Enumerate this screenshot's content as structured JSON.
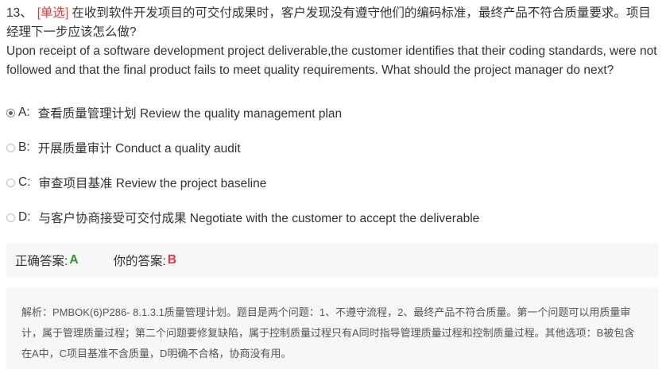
{
  "question": {
    "number": "13、",
    "type": "[单选]",
    "text_cn": "在收到软件开发项目的可交付成果时，客户发现没有遵守他们的编码标准，最终产品不符合质量要求。项目经理下一步应该怎么做?",
    "text_en": "Upon receipt of a software development project deliverable,the customer identifies that their coding standards, were not followed and that the final product fails to meet quality requirements. What should the project manager do next?"
  },
  "options": [
    {
      "letter": "A:",
      "text": "查看质量管理计划 Review the quality management plan",
      "selected": true
    },
    {
      "letter": "B:",
      "text": "开展质量审计 Conduct a quality audit",
      "selected": false
    },
    {
      "letter": "C:",
      "text": "审查项目基准 Review the project baseline",
      "selected": false
    },
    {
      "letter": "D:",
      "text": "与客户协商接受可交付成果 Negotiate with the customer to accept the deliverable",
      "selected": false
    }
  ],
  "answer": {
    "correct_label": "正确答案:",
    "correct_value": "A",
    "yours_label": "你的答案:",
    "yours_value": "B",
    "correct_color": "#2a9a2a",
    "wrong_color": "#e4393c"
  },
  "explanation": {
    "text": "解析：PMBOK(6)P286- 8.1.3.1质量管理计划。题目是两个问题：1、不遵守流程，2、最终产品不符合质量。第一个问题可以用质量审计，属于管理质量过程；第二个问题要修复缺陷，属于控制质量过程只有A同时指导管理质量过程和控制质量过程。其他选项：B被包含在A中，C项目基准不含质量，D明确不合格，协商没有用。"
  },
  "icons": {
    "radio_selected": "radio-selected-icon",
    "radio_unselected": "radio-unselected-icon"
  }
}
